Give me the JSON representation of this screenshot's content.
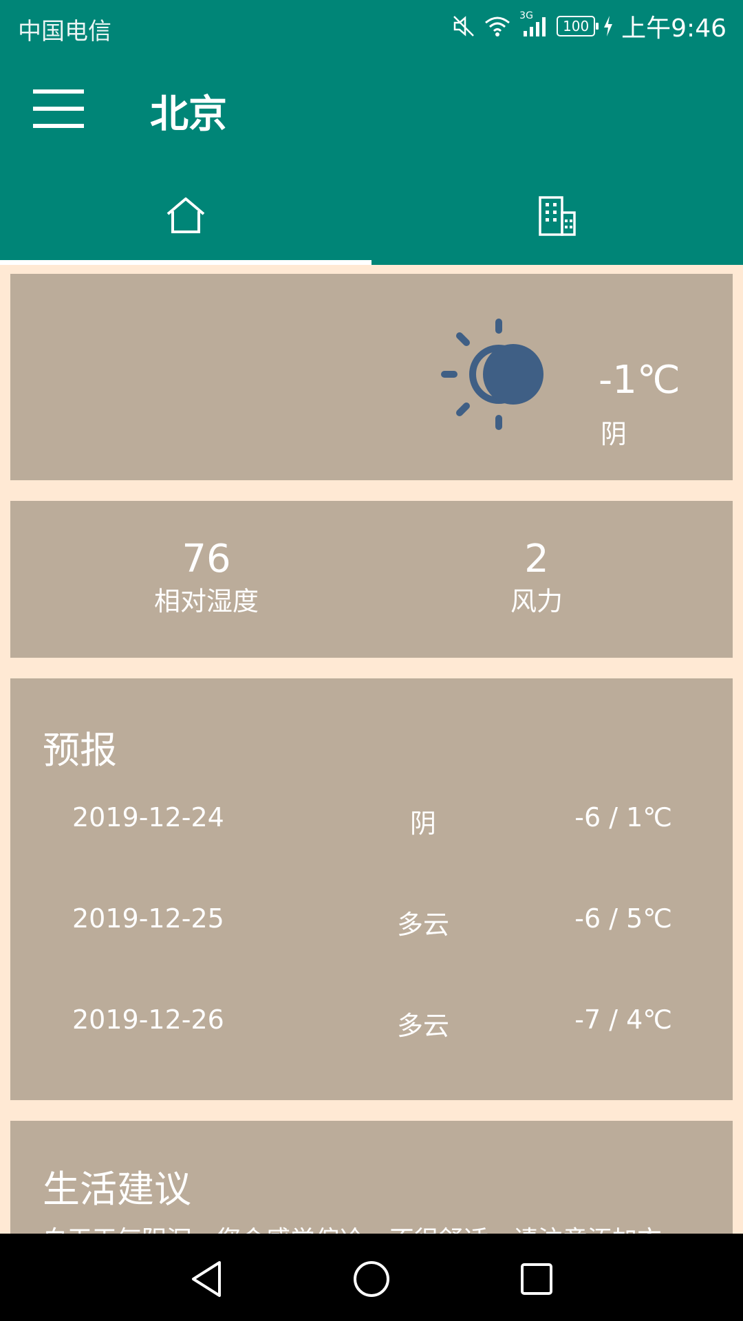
{
  "status_bar": {
    "carrier": "中国电信",
    "network": "3G",
    "battery": "100",
    "time": "上午9:46"
  },
  "toolbar": {
    "title": "北京",
    "menu_icon": "menu-icon"
  },
  "tabs": [
    {
      "icon": "home-icon",
      "selected": true
    },
    {
      "icon": "building-icon",
      "selected": false
    }
  ],
  "now": {
    "icon": "partly-cloudy-icon",
    "temperature": "-1℃",
    "condition": "阴"
  },
  "stats": {
    "humidity_value": "76",
    "humidity_label": "相对湿度",
    "wind_value": "2",
    "wind_label": "风力"
  },
  "forecast": {
    "title": "预报",
    "rows": [
      {
        "date": "2019-12-24",
        "condition": "阴",
        "range": "-6 / 1℃"
      },
      {
        "date": "2019-12-25",
        "condition": "多云",
        "range": "-6 / 5℃"
      },
      {
        "date": "2019-12-26",
        "condition": "多云",
        "range": "-7 / 4℃"
      }
    ]
  },
  "advice": {
    "title": "生活建议",
    "text": "白天天气阴沉，您会感觉偏冷，不很舒适，请注意添加衣"
  },
  "colors": {
    "primary": "#008577",
    "card": "#BBAC9A",
    "background": "#FFE9D4",
    "icon": "#3F5F85"
  }
}
